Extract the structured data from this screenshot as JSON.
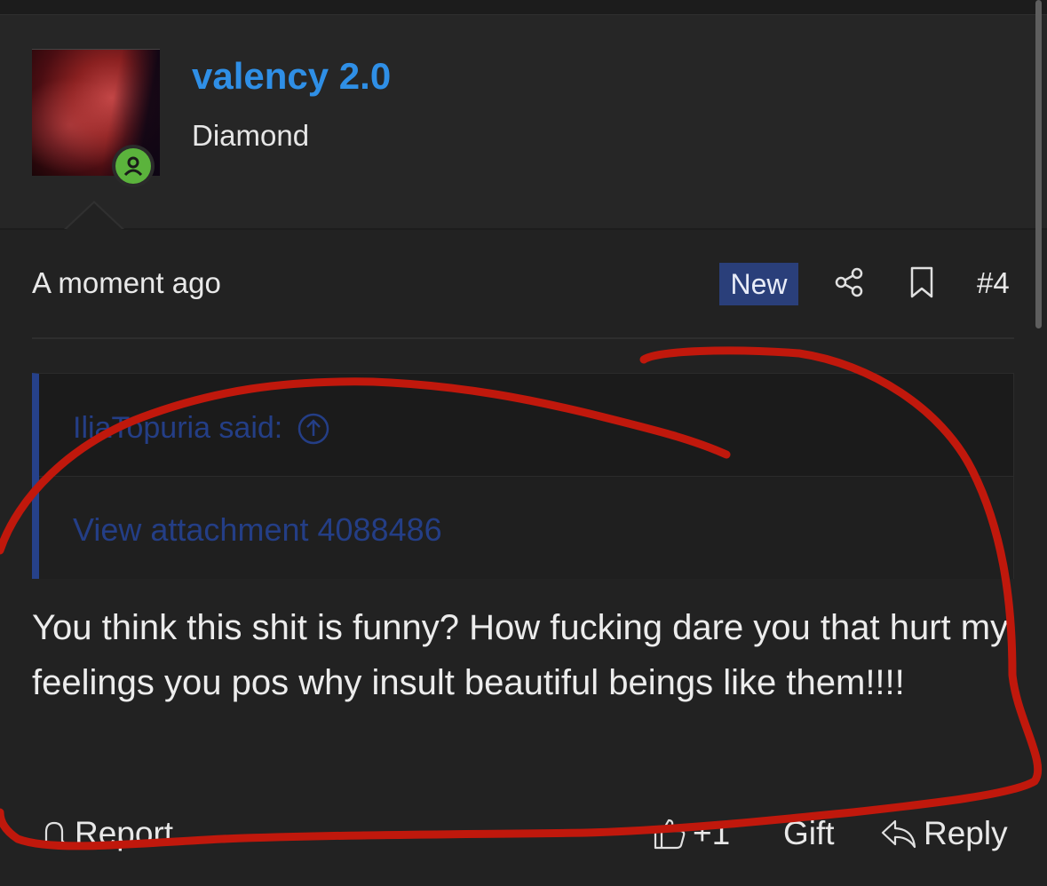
{
  "user": {
    "name": "valency 2.0",
    "rank": "Diamond",
    "status_icon": "online-user-icon",
    "status_color": "#5bb33c",
    "name_color": "#2f8fe6"
  },
  "post_meta": {
    "time": "A moment ago",
    "badge": "New",
    "post_number": "#4",
    "icons": [
      "share-icon",
      "bookmark-icon"
    ],
    "badge_color": "#2a3f7a"
  },
  "quote": {
    "author": "IliaTopuria said:",
    "attachment": "View attachment 4088486",
    "link_color": "#243e86"
  },
  "body": {
    "text": "You think this shit is funny? How fucking dare you that hurt my feelings you pos why insult beautiful beings like them!!!!"
  },
  "footer": {
    "report": "Report",
    "like_count": "+1",
    "gift": "Gift",
    "reply": "Reply"
  },
  "annotation": {
    "color": "#c0180c",
    "shape": "hand-drawn red circle"
  }
}
